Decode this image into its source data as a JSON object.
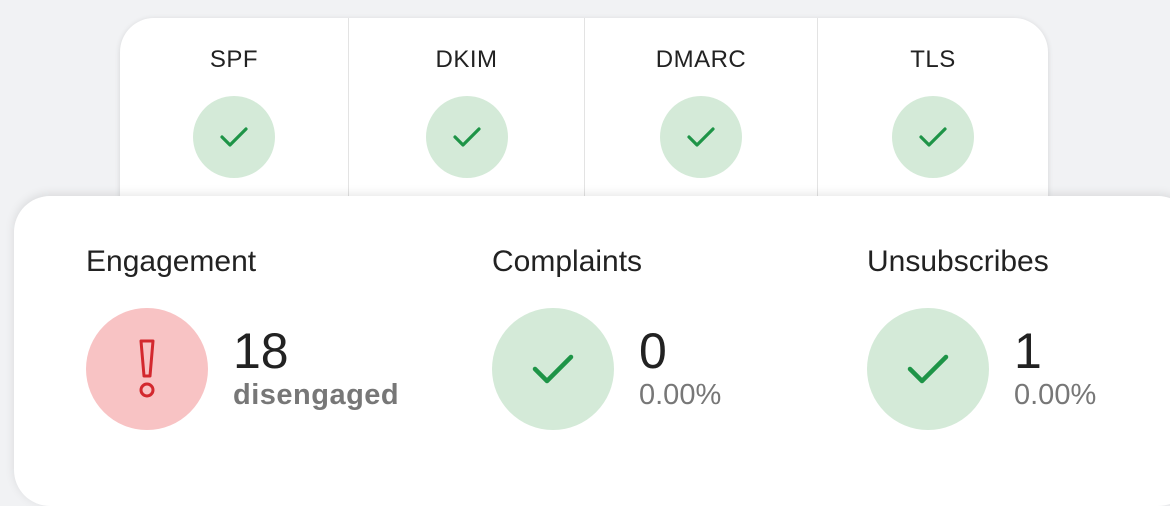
{
  "auth_checks": [
    {
      "label": "SPF",
      "status": "pass",
      "icon": "check-icon"
    },
    {
      "label": "DKIM",
      "status": "pass",
      "icon": "check-icon"
    },
    {
      "label": "DMARC",
      "status": "pass",
      "icon": "check-icon"
    },
    {
      "label": "TLS",
      "status": "pass",
      "icon": "check-icon"
    }
  ],
  "metrics": [
    {
      "title": "Engagement",
      "value": "18",
      "sub": "disengaged",
      "status": "warning",
      "icon": "exclamation-icon"
    },
    {
      "title": "Complaints",
      "value": "0",
      "sub": "0.00%",
      "status": "pass",
      "icon": "check-icon"
    },
    {
      "title": "Unsubscribes",
      "value": "1",
      "sub": "0.00%",
      "status": "pass",
      "icon": "check-icon"
    }
  ],
  "colors": {
    "pass_bg": "#d4ead8",
    "pass_check": "#1e9447",
    "warning_bg": "#f8c3c4",
    "warning_icon": "#d3282e",
    "sub_text": "#777777"
  }
}
